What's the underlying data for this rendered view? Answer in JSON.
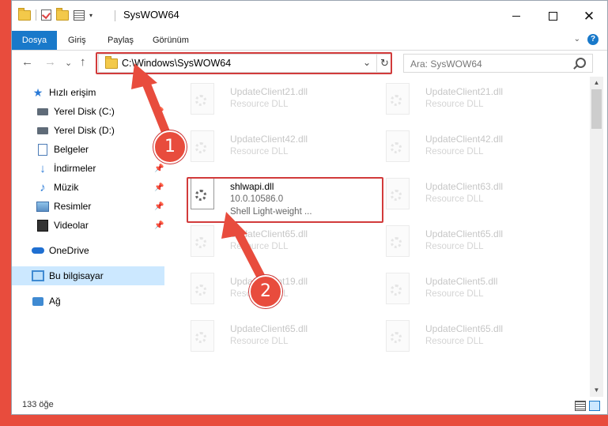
{
  "window": {
    "title": "SysWOW64",
    "minimize_icon": "minimize-icon",
    "maximize_icon": "maximize-icon",
    "close_glyph": "✕"
  },
  "ribbon": {
    "tabs": [
      "Dosya",
      "Giriş",
      "Paylaş",
      "Görünüm"
    ],
    "help_glyph": "?",
    "collapse_glyph": "⌄"
  },
  "nav": {
    "back_glyph": "←",
    "forward_glyph": "→",
    "recent_glyph": "⌄",
    "up_glyph": "↑",
    "address": "C:\\Windows\\SysWOW64",
    "address_chevron": "⌄",
    "refresh_glyph": "↻",
    "search_placeholder": "Ara: SysWOW64"
  },
  "sidebar": {
    "items": [
      {
        "label": "Hızlı erişim",
        "icon": "star-icon"
      },
      {
        "label": "Yerel Disk (C:)",
        "icon": "disk-icon"
      },
      {
        "label": "Yerel Disk (D:)",
        "icon": "disk-icon"
      },
      {
        "label": "Belgeler",
        "icon": "document-icon"
      },
      {
        "label": "İndirmeler",
        "icon": "download-icon"
      },
      {
        "label": "Müzik",
        "icon": "music-icon"
      },
      {
        "label": "Resimler",
        "icon": "pictures-icon"
      },
      {
        "label": "Videolar",
        "icon": "videos-icon"
      },
      {
        "label": "OneDrive",
        "icon": "cloud-icon"
      },
      {
        "label": "Bu bilgisayar",
        "icon": "computer-icon"
      },
      {
        "label": "Ağ",
        "icon": "network-icon"
      }
    ],
    "pin_glyph": "📌"
  },
  "files": {
    "left": [
      {
        "name": "UpdateClient21.dll",
        "desc": "Resource DLL"
      },
      {
        "name": "UpdateClient42.dll",
        "desc": "Resource DLL"
      },
      {
        "name": "shlwapi.dll",
        "version": "10.0.10586.0",
        "desc": "Shell Light-weight ..."
      },
      {
        "name": "UpdateClient65.dll",
        "desc": "Resource DLL"
      },
      {
        "name": "UpdateClient19.dll",
        "desc": "Resource DLL"
      },
      {
        "name": "UpdateClient65.dll",
        "desc": "Resource DLL"
      }
    ],
    "right": [
      {
        "name": "UpdateClient21.dll",
        "desc": "Resource DLL"
      },
      {
        "name": "UpdateClient42.dll",
        "desc": "Resource DLL"
      },
      {
        "name": "UpdateClient63.dll",
        "desc": "Resource DLL"
      },
      {
        "name": "UpdateClient65.dll",
        "desc": "Resource DLL"
      },
      {
        "name": "UpdateClient5.dll",
        "desc": "Resource DLL"
      },
      {
        "name": "UpdateClient65.dll",
        "desc": "Resource DLL"
      }
    ]
  },
  "status": {
    "item_count": "133 öğe"
  },
  "callouts": [
    {
      "number": "1"
    },
    {
      "number": "2"
    }
  ],
  "colors": {
    "accent": "#1979ca",
    "highlight": "#d23b3b",
    "background": "#e84c3d"
  }
}
